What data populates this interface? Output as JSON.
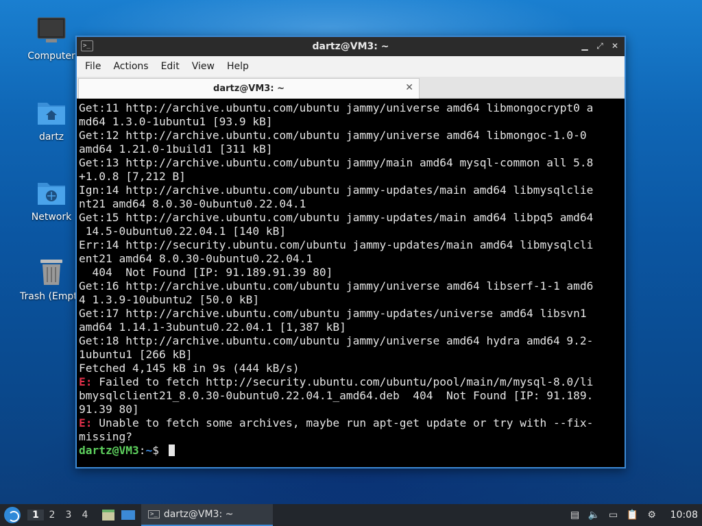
{
  "desktop": {
    "icons": [
      {
        "label": "Computer",
        "icon": "computer-icon"
      },
      {
        "label": "dartz",
        "icon": "home-folder-icon"
      },
      {
        "label": "Network",
        "icon": "network-folder-icon"
      },
      {
        "label": "Trash (Empty)",
        "icon": "trash-icon"
      }
    ]
  },
  "window": {
    "title": "dartz@VM3: ~",
    "menu": [
      "File",
      "Actions",
      "Edit",
      "View",
      "Help"
    ],
    "tab": {
      "label": "dartz@VM3: ~"
    },
    "colors": {
      "accent": "#3c8ad6",
      "terminal_bg": "#000000",
      "error": "#e0304a",
      "prompt_user": "#5ed15e",
      "prompt_path": "#3d8ee8"
    }
  },
  "terminal": {
    "lines": [
      "Get:11 http://archive.ubuntu.com/ubuntu jammy/universe amd64 libmongocrypt0 a",
      "md64 1.3.0-1ubuntu1 [93.9 kB]",
      "Get:12 http://archive.ubuntu.com/ubuntu jammy/universe amd64 libmongoc-1.0-0",
      "amd64 1.21.0-1build1 [311 kB]",
      "Get:13 http://archive.ubuntu.com/ubuntu jammy/main amd64 mysql-common all 5.8",
      "+1.0.8 [7,212 B]",
      "Ign:14 http://archive.ubuntu.com/ubuntu jammy-updates/main amd64 libmysqlclie",
      "nt21 amd64 8.0.30-0ubuntu0.22.04.1",
      "Get:15 http://archive.ubuntu.com/ubuntu jammy-updates/main amd64 libpq5 amd64",
      " 14.5-0ubuntu0.22.04.1 [140 kB]",
      "Err:14 http://security.ubuntu.com/ubuntu jammy-updates/main amd64 libmysqlcli",
      "ent21 amd64 8.0.30-0ubuntu0.22.04.1",
      "  404  Not Found [IP: 91.189.91.39 80]",
      "Get:16 http://archive.ubuntu.com/ubuntu jammy/universe amd64 libserf-1-1 amd6",
      "4 1.3.9-10ubuntu2 [50.0 kB]",
      "Get:17 http://archive.ubuntu.com/ubuntu jammy-updates/universe amd64 libsvn1",
      "amd64 1.14.1-3ubuntu0.22.04.1 [1,387 kB]",
      "Get:18 http://archive.ubuntu.com/ubuntu jammy/universe amd64 hydra amd64 9.2-",
      "1ubuntu1 [266 kB]",
      "Fetched 4,145 kB in 9s (444 kB/s)"
    ],
    "errors": [
      {
        "prefix": "E:",
        "lines": [
          " Failed to fetch http://security.ubuntu.com/ubuntu/pool/main/m/mysql-8.0/li",
          "bmysqlclient21_8.0.30-0ubuntu0.22.04.1_amd64.deb  404  Not Found [IP: 91.189.",
          "91.39 80]"
        ]
      },
      {
        "prefix": "E:",
        "lines": [
          " Unable to fetch some archives, maybe run apt-get update or try with --fix-",
          "missing?"
        ]
      }
    ],
    "prompt": {
      "user_host": "dartz@VM3",
      "sep": ":",
      "path": "~",
      "symbol": "$ "
    }
  },
  "taskbar": {
    "workspaces": [
      "1",
      "2",
      "3",
      "4"
    ],
    "active_workspace": "1",
    "task": {
      "label": "dartz@VM3: ~"
    },
    "clock": "10:08",
    "tray_icons": [
      "keyboard-layout-icon",
      "volume-icon",
      "display-icon",
      "clipboard-icon",
      "update-notifier-icon"
    ]
  }
}
